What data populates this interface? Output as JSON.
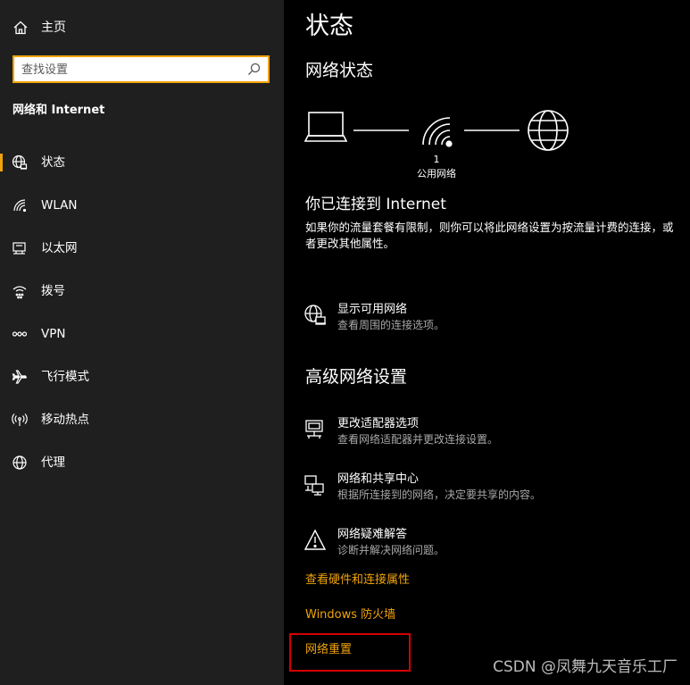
{
  "sidebar": {
    "home_label": "主页",
    "search_placeholder": "查找设置",
    "section_title": "网络和 Internet",
    "items": [
      {
        "label": "状态",
        "icon": "globe-status-icon",
        "active": true
      },
      {
        "label": "WLAN",
        "icon": "wifi-icon"
      },
      {
        "label": "以太网",
        "icon": "ethernet-icon"
      },
      {
        "label": "拨号",
        "icon": "dialup-icon"
      },
      {
        "label": "VPN",
        "icon": "vpn-icon"
      },
      {
        "label": "飞行模式",
        "icon": "airplane-icon"
      },
      {
        "label": "移动热点",
        "icon": "hotspot-icon"
      },
      {
        "label": "代理",
        "icon": "globe-icon"
      }
    ]
  },
  "main": {
    "title": "状态",
    "network_status_heading": "网络状态",
    "diagram": {
      "network_number": "1",
      "network_type": "公用网络"
    },
    "connected_heading": "你已连接到 Internet",
    "connected_desc": "如果你的流量套餐有限制，则你可以将此网络设置为按流量计费的连接，或者更改其他属性。",
    "show_networks": {
      "title": "显示可用网络",
      "subtitle": "查看周围的连接选项。"
    },
    "advanced_heading": "高级网络设置",
    "settings": [
      {
        "title": "更改适配器选项",
        "subtitle": "查看网络适配器并更改连接设置。"
      },
      {
        "title": "网络和共享中心",
        "subtitle": "根据所连接到的网络，决定要共享的内容。"
      },
      {
        "title": "网络疑难解答",
        "subtitle": "诊断并解决网络问题。"
      }
    ],
    "links": [
      "查看硬件和连接属性",
      "Windows 防火墙",
      "网络重置"
    ]
  },
  "watermark": "CSDN @凤舞九天音乐工厂",
  "colors": {
    "accent": "#f0a30a",
    "sidebar_bg": "#1f1f1f",
    "main_bg": "#000000",
    "highlight": "#d40000"
  }
}
